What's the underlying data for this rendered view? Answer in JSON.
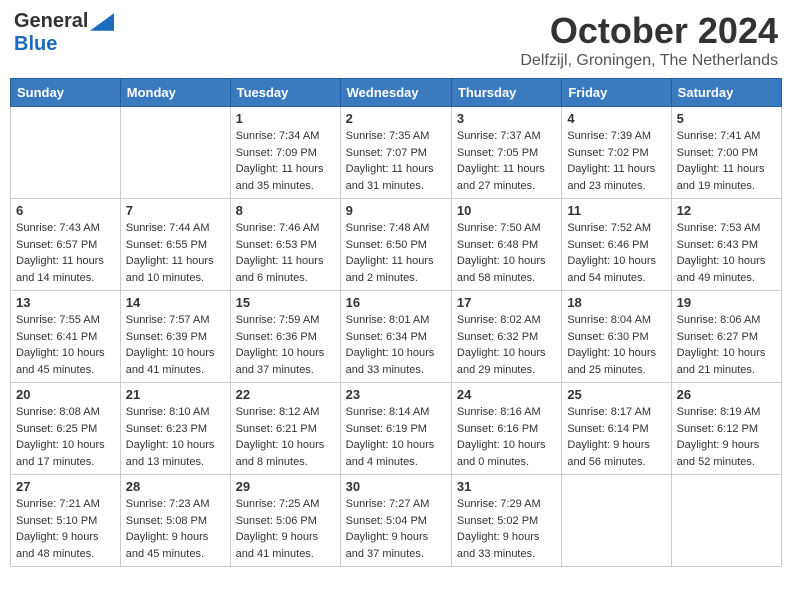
{
  "header": {
    "logo": {
      "general": "General",
      "blue": "Blue"
    },
    "title": "October 2024",
    "location": "Delfzijl, Groningen, The Netherlands"
  },
  "days_of_week": [
    "Sunday",
    "Monday",
    "Tuesday",
    "Wednesday",
    "Thursday",
    "Friday",
    "Saturday"
  ],
  "weeks": [
    [
      {
        "day": "",
        "sunrise": "",
        "sunset": "",
        "daylight": ""
      },
      {
        "day": "",
        "sunrise": "",
        "sunset": "",
        "daylight": ""
      },
      {
        "day": "1",
        "sunrise": "Sunrise: 7:34 AM",
        "sunset": "Sunset: 7:09 PM",
        "daylight": "Daylight: 11 hours and 35 minutes."
      },
      {
        "day": "2",
        "sunrise": "Sunrise: 7:35 AM",
        "sunset": "Sunset: 7:07 PM",
        "daylight": "Daylight: 11 hours and 31 minutes."
      },
      {
        "day": "3",
        "sunrise": "Sunrise: 7:37 AM",
        "sunset": "Sunset: 7:05 PM",
        "daylight": "Daylight: 11 hours and 27 minutes."
      },
      {
        "day": "4",
        "sunrise": "Sunrise: 7:39 AM",
        "sunset": "Sunset: 7:02 PM",
        "daylight": "Daylight: 11 hours and 23 minutes."
      },
      {
        "day": "5",
        "sunrise": "Sunrise: 7:41 AM",
        "sunset": "Sunset: 7:00 PM",
        "daylight": "Daylight: 11 hours and 19 minutes."
      }
    ],
    [
      {
        "day": "6",
        "sunrise": "Sunrise: 7:43 AM",
        "sunset": "Sunset: 6:57 PM",
        "daylight": "Daylight: 11 hours and 14 minutes."
      },
      {
        "day": "7",
        "sunrise": "Sunrise: 7:44 AM",
        "sunset": "Sunset: 6:55 PM",
        "daylight": "Daylight: 11 hours and 10 minutes."
      },
      {
        "day": "8",
        "sunrise": "Sunrise: 7:46 AM",
        "sunset": "Sunset: 6:53 PM",
        "daylight": "Daylight: 11 hours and 6 minutes."
      },
      {
        "day": "9",
        "sunrise": "Sunrise: 7:48 AM",
        "sunset": "Sunset: 6:50 PM",
        "daylight": "Daylight: 11 hours and 2 minutes."
      },
      {
        "day": "10",
        "sunrise": "Sunrise: 7:50 AM",
        "sunset": "Sunset: 6:48 PM",
        "daylight": "Daylight: 10 hours and 58 minutes."
      },
      {
        "day": "11",
        "sunrise": "Sunrise: 7:52 AM",
        "sunset": "Sunset: 6:46 PM",
        "daylight": "Daylight: 10 hours and 54 minutes."
      },
      {
        "day": "12",
        "sunrise": "Sunrise: 7:53 AM",
        "sunset": "Sunset: 6:43 PM",
        "daylight": "Daylight: 10 hours and 49 minutes."
      }
    ],
    [
      {
        "day": "13",
        "sunrise": "Sunrise: 7:55 AM",
        "sunset": "Sunset: 6:41 PM",
        "daylight": "Daylight: 10 hours and 45 minutes."
      },
      {
        "day": "14",
        "sunrise": "Sunrise: 7:57 AM",
        "sunset": "Sunset: 6:39 PM",
        "daylight": "Daylight: 10 hours and 41 minutes."
      },
      {
        "day": "15",
        "sunrise": "Sunrise: 7:59 AM",
        "sunset": "Sunset: 6:36 PM",
        "daylight": "Daylight: 10 hours and 37 minutes."
      },
      {
        "day": "16",
        "sunrise": "Sunrise: 8:01 AM",
        "sunset": "Sunset: 6:34 PM",
        "daylight": "Daylight: 10 hours and 33 minutes."
      },
      {
        "day": "17",
        "sunrise": "Sunrise: 8:02 AM",
        "sunset": "Sunset: 6:32 PM",
        "daylight": "Daylight: 10 hours and 29 minutes."
      },
      {
        "day": "18",
        "sunrise": "Sunrise: 8:04 AM",
        "sunset": "Sunset: 6:30 PM",
        "daylight": "Daylight: 10 hours and 25 minutes."
      },
      {
        "day": "19",
        "sunrise": "Sunrise: 8:06 AM",
        "sunset": "Sunset: 6:27 PM",
        "daylight": "Daylight: 10 hours and 21 minutes."
      }
    ],
    [
      {
        "day": "20",
        "sunrise": "Sunrise: 8:08 AM",
        "sunset": "Sunset: 6:25 PM",
        "daylight": "Daylight: 10 hours and 17 minutes."
      },
      {
        "day": "21",
        "sunrise": "Sunrise: 8:10 AM",
        "sunset": "Sunset: 6:23 PM",
        "daylight": "Daylight: 10 hours and 13 minutes."
      },
      {
        "day": "22",
        "sunrise": "Sunrise: 8:12 AM",
        "sunset": "Sunset: 6:21 PM",
        "daylight": "Daylight: 10 hours and 8 minutes."
      },
      {
        "day": "23",
        "sunrise": "Sunrise: 8:14 AM",
        "sunset": "Sunset: 6:19 PM",
        "daylight": "Daylight: 10 hours and 4 minutes."
      },
      {
        "day": "24",
        "sunrise": "Sunrise: 8:16 AM",
        "sunset": "Sunset: 6:16 PM",
        "daylight": "Daylight: 10 hours and 0 minutes."
      },
      {
        "day": "25",
        "sunrise": "Sunrise: 8:17 AM",
        "sunset": "Sunset: 6:14 PM",
        "daylight": "Daylight: 9 hours and 56 minutes."
      },
      {
        "day": "26",
        "sunrise": "Sunrise: 8:19 AM",
        "sunset": "Sunset: 6:12 PM",
        "daylight": "Daylight: 9 hours and 52 minutes."
      }
    ],
    [
      {
        "day": "27",
        "sunrise": "Sunrise: 7:21 AM",
        "sunset": "Sunset: 5:10 PM",
        "daylight": "Daylight: 9 hours and 48 minutes."
      },
      {
        "day": "28",
        "sunrise": "Sunrise: 7:23 AM",
        "sunset": "Sunset: 5:08 PM",
        "daylight": "Daylight: 9 hours and 45 minutes."
      },
      {
        "day": "29",
        "sunrise": "Sunrise: 7:25 AM",
        "sunset": "Sunset: 5:06 PM",
        "daylight": "Daylight: 9 hours and 41 minutes."
      },
      {
        "day": "30",
        "sunrise": "Sunrise: 7:27 AM",
        "sunset": "Sunset: 5:04 PM",
        "daylight": "Daylight: 9 hours and 37 minutes."
      },
      {
        "day": "31",
        "sunrise": "Sunrise: 7:29 AM",
        "sunset": "Sunset: 5:02 PM",
        "daylight": "Daylight: 9 hours and 33 minutes."
      },
      {
        "day": "",
        "sunrise": "",
        "sunset": "",
        "daylight": ""
      },
      {
        "day": "",
        "sunrise": "",
        "sunset": "",
        "daylight": ""
      }
    ]
  ]
}
